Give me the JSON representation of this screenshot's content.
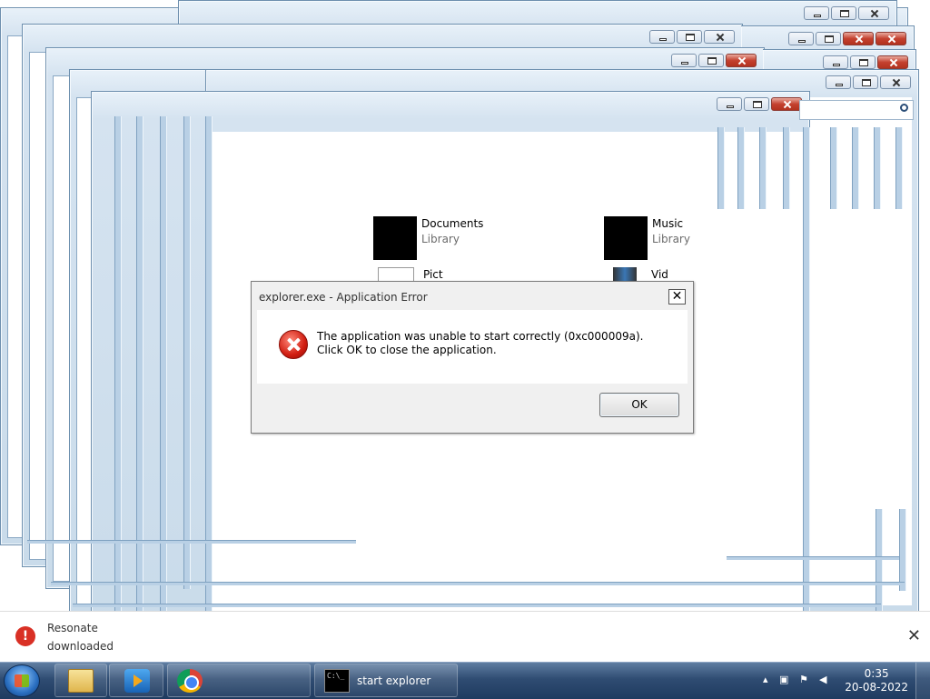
{
  "explorer": {
    "libraries": [
      {
        "name": "Documents",
        "type": "Library"
      },
      {
        "name": "Music",
        "type": "Library"
      },
      {
        "name": "Pict",
        "type": ""
      },
      {
        "name": "Vid",
        "type": ""
      }
    ]
  },
  "dialog": {
    "title": "explorer.exe - Application Error",
    "message": "The application was unable to start correctly (0xc000009a). Click OK to close the application.",
    "ok_label": "OK",
    "close_glyph": "✕",
    "icon": "error-icon"
  },
  "notification": {
    "line1": "Resonate",
    "line2": "downloaded",
    "close_glyph": "✕"
  },
  "taskbar": {
    "cmd_label": "start  explorer",
    "time": "0:35",
    "date": "20-08-2022",
    "icons": [
      "windows-start-icon",
      "folder-icon",
      "media-player-icon",
      "chrome-icon",
      "cmd-icon"
    ]
  },
  "colors": {
    "window_frame": "#c9dbea",
    "taskbar": "#2f4c72",
    "error_red": "#d11e12"
  }
}
